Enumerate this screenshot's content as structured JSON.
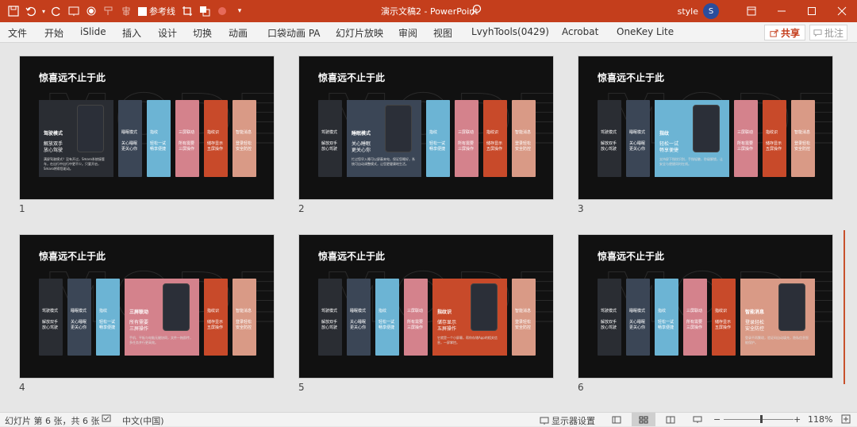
{
  "titlebar": {
    "doc_title": "演示文稿2  -  PowerPoint",
    "checkbox_label": "参考线",
    "user_name": "style",
    "avatar_initial": "S"
  },
  "ribbon": {
    "tabs": [
      "文件",
      "开始",
      "iSlide",
      "插入",
      "设计",
      "切换",
      "动画",
      "口袋动画 PA",
      "幻灯片放映",
      "审阅",
      "视图",
      "LvyhTools(0429)",
      "Acrobat",
      "OneKey Lite"
    ],
    "share_label": "共享",
    "comment_label": "批注"
  },
  "slides": [
    {
      "number": "1",
      "title": "惊喜远不止于此",
      "watermark": "MODE",
      "panel_title": "驾驶模式",
      "panel_sub": "解放双手\n放心驾驶",
      "panel_body": "满屏驾驶模式？没有开过，Smaro系统接管车，在出行中出行中更不少。只要开启，Smaro将帮您驱动。",
      "strips": [
        {
          "label": "睡眠模式\n\n关心睡眠\n更关心你"
        },
        {
          "label": "指纹 \n\n轻松一试\n畅享便捷"
        },
        {
          "label": "三屏联动\n\n所有需要\n三屏操作"
        },
        {
          "label": "指纹识\n\n储存显示\n五屏操作"
        },
        {
          "label": "智能消息\n\n登录轻松\n安全防控"
        }
      ]
    },
    {
      "number": "2",
      "title": "惊喜远不止于此",
      "watermark": "MODE",
      "panel_title": "睡眠模式",
      "panel_sub": "关心睡眠\n更关心你",
      "panel_body": "忙过您早入睡可以屏蔽来电，保证您睡好，系统可自动调整模式，让您更健康地生活。",
      "strips": [
        {
          "label": "驾驶模式\n\n解放双手\n放心驾驶"
        },
        {
          "label": "指纹\n\n轻松一试\n畅享便捷"
        },
        {
          "label": "三屏联动\n\n所有需要\n三屏操作"
        },
        {
          "label": "指纹识\n\n储存显示\n五屏操作"
        },
        {
          "label": "智能消息\n\n登录轻松\n安全防控"
        }
      ]
    },
    {
      "number": "3",
      "title": "惊喜远不止于此",
      "watermark": "MODE",
      "panel_title": "指纹",
      "panel_sub": "轻松一试\n畅享便捷",
      "panel_body": "支持屏下指纹识别，手指轻触，秒级解锁，让安全与便捷同时在线。",
      "strips": [
        {
          "label": "驾驶模式\n\n解放双手\n放心驾驶"
        },
        {
          "label": "睡眠模式\n\n关心睡眠\n更关心你"
        },
        {
          "label": "三屏联动\n\n所有需要\n三屏操作"
        },
        {
          "label": "指纹识\n\n储存显示\n五屏操作"
        },
        {
          "label": "智能消息\n\n登录轻松\n安全防控"
        }
      ]
    },
    {
      "number": "4",
      "title": "惊喜远不止于此",
      "watermark": "MODE",
      "panel_title": "三屏联动",
      "panel_sub": "所有需要\n三屏操作",
      "panel_body": "手机、平板与电脑无缝协同，文件一拖即传，多任务并行更高效。",
      "strips": [
        {
          "label": "驾驶模式\n\n解放双手\n放心驾驶"
        },
        {
          "label": "睡眠模式\n\n关心睡眠\n更关心你"
        },
        {
          "label": "指纹\n\n轻松一试\n畅享便捷"
        },
        {
          "label": "指纹识\n\n储存显示\n五屏操作"
        },
        {
          "label": "智能消息\n\n登录轻松\n安全防控"
        }
      ]
    },
    {
      "number": "5",
      "title": "惊喜远不止于此",
      "watermark": "MODE",
      "panel_title": "指纹识",
      "panel_sub": "储存显示\n五屏操作",
      "panel_body": "它就是一个小屏幕，帮你存储App的相关信息，一屏掌控。",
      "strips": [
        {
          "label": "驾驶模式\n\n解放双手\n放心驾驶"
        },
        {
          "label": "睡眠模式\n\n关心睡眠\n更关心你"
        },
        {
          "label": "指纹\n\n轻松一试\n畅享便捷"
        },
        {
          "label": "三屏联动\n\n所有需要\n三屏操作"
        },
        {
          "label": "智能消息\n\n登录轻松\n安全防控"
        }
      ]
    },
    {
      "number": "6",
      "title": "惊喜远不止于此",
      "watermark": "MODE",
      "panel_title": "智能消息",
      "panel_sub": "登录轻松\n安全防控",
      "panel_body": "登录不再繁琐，验证码自动填充，隐私信息智能保护。",
      "strips": [
        {
          "label": "驾驶模式\n\n解放双手\n放心驾驶"
        },
        {
          "label": "睡眠模式\n\n关心睡眠\n更关心你"
        },
        {
          "label": "指纹\n\n轻松一试\n畅享便捷"
        },
        {
          "label": "三屏联动\n\n所有需要\n三屏操作"
        },
        {
          "label": "指纹识\n\n储存显示\n五屏操作"
        }
      ]
    }
  ],
  "status": {
    "slide_info": "幻灯片 第 6 张，共 6 张",
    "language": "中文(中国)",
    "display_settings": "显示器设置",
    "zoom": "118%"
  },
  "colors": {
    "accent": "#c43e1c",
    "strip_colors": [
      "#2a2d33",
      "#3b4656",
      "#6cb4d4",
      "#d4828c",
      "#c84a2a",
      "#d99a86"
    ]
  }
}
